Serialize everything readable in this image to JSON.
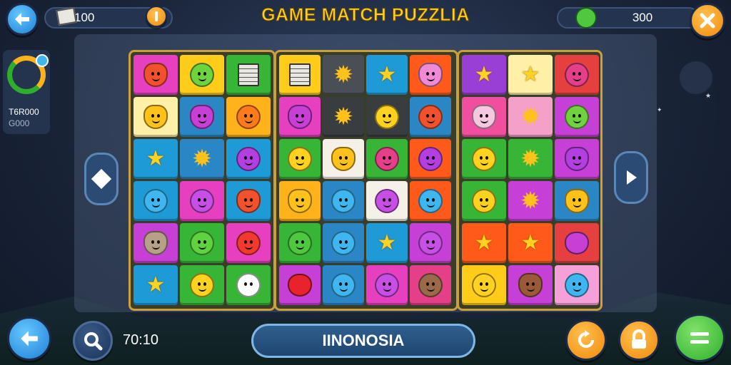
{
  "header": {
    "title": "GAME MATCH PUZZLIA",
    "left_counter": "100",
    "right_counter": "300"
  },
  "sidebar": {
    "score_line1": "T6R000",
    "score_line2": "G000"
  },
  "footer": {
    "timer": "70:10",
    "level_name": "IINONOSIA"
  },
  "icons": {
    "back": "arrow-left-icon",
    "coin": "coin-icon",
    "close": "close-icon",
    "refresh": "refresh-icon",
    "lock": "lock-icon",
    "menu": "menu-icon",
    "search": "search-icon"
  },
  "colors": {
    "title": "#ffd21f",
    "accent_orange": "#f08a0c",
    "accent_blue": "#1f7fd6",
    "accent_green": "#2fae2c",
    "panel_border": "#c9a03a"
  },
  "boards": [
    {
      "tiles": [
        {
          "bg": "#e63fc0",
          "kind": "cat",
          "color": "#f2512e"
        },
        {
          "bg": "#ffcc1a",
          "kind": "face",
          "color": "#6fd23f"
        },
        {
          "bg": "#36b536",
          "kind": "book",
          "color": "#e8e8e0"
        },
        {
          "bg": "#fff0a8",
          "kind": "cat",
          "color": "#ffc21a"
        },
        {
          "bg": "#2a86c4",
          "kind": "cat",
          "color": "#c83fd6"
        },
        {
          "bg": "#ffb21a",
          "kind": "face",
          "color": "#ff7a1a"
        },
        {
          "bg": "#1e9ad6",
          "kind": "star",
          "color": "#ffd21f"
        },
        {
          "bg": "#2a86c4",
          "kind": "blob",
          "color": "#ffc21a"
        },
        {
          "bg": "#1e9ad6",
          "kind": "face",
          "color": "#b43fe0"
        },
        {
          "bg": "#1e9ad6",
          "kind": "face",
          "color": "#3fb6f0"
        },
        {
          "bg": "#e63fc0",
          "kind": "face",
          "color": "#c84fe6"
        },
        {
          "bg": "#1e9ad6",
          "kind": "cat",
          "color": "#f2512e"
        },
        {
          "bg": "#c63fd6",
          "kind": "cat",
          "color": "#b8a088"
        },
        {
          "bg": "#36b536",
          "kind": "face",
          "color": "#5fd23f"
        },
        {
          "bg": "#e63fc0",
          "kind": "face",
          "color": "#f2392e"
        },
        {
          "bg": "#1e9ad6",
          "kind": "star",
          "color": "#ffd21f"
        },
        {
          "bg": "#36b536",
          "kind": "face",
          "color": "#ffd21f"
        },
        {
          "bg": "#36b536",
          "kind": "skull",
          "color": "#ffffff"
        }
      ]
    },
    {
      "tiles": [
        {
          "bg": "#ffcc1a",
          "kind": "book",
          "color": "#e8e8e0"
        },
        {
          "bg": "#4a4f55",
          "kind": "blob",
          "color": "#ffc21a"
        },
        {
          "bg": "#1e9ad6",
          "kind": "star",
          "color": "#ffd21f"
        },
        {
          "bg": "#ff5a1a",
          "kind": "cat",
          "color": "#f08ad6"
        },
        {
          "bg": "#e63fc0",
          "kind": "cat",
          "color": "#c83fd6"
        },
        {
          "bg": "#3a3d40",
          "kind": "blob",
          "color": "#ffc21a"
        },
        {
          "bg": "#3a3d40",
          "kind": "face",
          "color": "#ffd21f"
        },
        {
          "bg": "#2a86c4",
          "kind": "face",
          "color": "#f2512e"
        },
        {
          "bg": "#36b536",
          "kind": "face",
          "color": "#ffd21f"
        },
        {
          "bg": "#f5f0e8",
          "kind": "cat",
          "color": "#ffc21a"
        },
        {
          "bg": "#36b536",
          "kind": "face",
          "color": "#e63f8a"
        },
        {
          "bg": "#ff5a1a",
          "kind": "face",
          "color": "#b43fe0"
        },
        {
          "bg": "#ffb21a",
          "kind": "cat",
          "color": "#ffc21a"
        },
        {
          "bg": "#2a86c4",
          "kind": "face",
          "color": "#3fb6f0"
        },
        {
          "bg": "#f5f0e8",
          "kind": "face",
          "color": "#c84fe6"
        },
        {
          "bg": "#ff5a1a",
          "kind": "face",
          "color": "#3fb6f0"
        },
        {
          "bg": "#36b536",
          "kind": "face",
          "color": "#4fc83f"
        },
        {
          "bg": "#2a86c4",
          "kind": "face",
          "color": "#3fb6f0"
        },
        {
          "bg": "#1e9ad6",
          "kind": "star",
          "color": "#ffd21f"
        },
        {
          "bg": "#c63fd6",
          "kind": "face",
          "color": "#c84fe6"
        },
        {
          "bg": "#c63fd6",
          "kind": "apple",
          "color": "#e8232e"
        },
        {
          "bg": "#2a86c4",
          "kind": "face",
          "color": "#3fb6f0"
        },
        {
          "bg": "#e63fc0",
          "kind": "face",
          "color": "#c84fe6"
        },
        {
          "bg": "#e63f8a",
          "kind": "face",
          "color": "#9a6a4a"
        }
      ]
    },
    {
      "tiles": [
        {
          "bg": "#9a3fd6",
          "kind": "star",
          "color": "#ffd21f"
        },
        {
          "bg": "#fff0a8",
          "kind": "star",
          "color": "#ffd21f"
        },
        {
          "bg": "#e63f3f",
          "kind": "face",
          "color": "#e63f8a"
        },
        {
          "bg": "#f04fa0",
          "kind": "cat",
          "color": "#f5c8e0"
        },
        {
          "bg": "#f5a0c8",
          "kind": "blob",
          "color": "#ffc21a"
        },
        {
          "bg": "#c63fd6",
          "kind": "face",
          "color": "#6fd23f"
        },
        {
          "bg": "#36b536",
          "kind": "face",
          "color": "#ffd21f"
        },
        {
          "bg": "#36b536",
          "kind": "blob",
          "color": "#ffc21a"
        },
        {
          "bg": "#c63fd6",
          "kind": "cat",
          "color": "#b43fe0"
        },
        {
          "bg": "#36b536",
          "kind": "face",
          "color": "#ffd21f"
        },
        {
          "bg": "#c63fd6",
          "kind": "blob",
          "color": "#ffc21a"
        },
        {
          "bg": "#2a86c4",
          "kind": "cat",
          "color": "#ffc21a"
        },
        {
          "bg": "#ff5a1a",
          "kind": "star",
          "color": "#ffd21f"
        },
        {
          "bg": "#ff5a1a",
          "kind": "star",
          "color": "#ffd21f"
        },
        {
          "bg": "#e63f3f",
          "kind": "apple",
          "color": "#c83fd6"
        },
        {
          "bg": "#ffcc1a",
          "kind": "face",
          "color": "#ffd21f"
        },
        {
          "bg": "#c63fd6",
          "kind": "cat",
          "color": "#9a5a3a"
        },
        {
          "bg": "#f5a0d8",
          "kind": "face",
          "color": "#3fb6f0"
        }
      ]
    }
  ]
}
